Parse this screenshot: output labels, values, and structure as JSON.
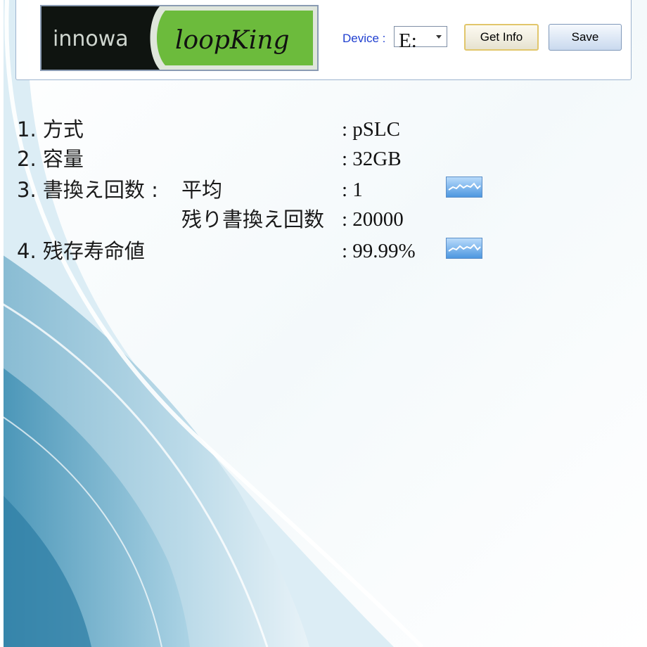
{
  "header": {
    "logo": {
      "brand_left": "innowa",
      "brand_right": "loopKing"
    },
    "device": {
      "label": "Device :",
      "value": "E:"
    },
    "buttons": {
      "get_info": "Get Info",
      "save": "Save"
    }
  },
  "info": {
    "row1": {
      "label": "1. 方式",
      "value": ": pSLC"
    },
    "row2": {
      "label": "2. 容量",
      "value": ": 32GB"
    },
    "row3": {
      "label": "3. 書換え回数 :",
      "sub1": {
        "label": "平均",
        "value": ": 1"
      },
      "sub2": {
        "label": "残り書換え回数",
        "value": ": 20000"
      }
    },
    "row4": {
      "label": "4. 残存寿命値",
      "value": ": 99.99%"
    }
  },
  "icons": {
    "chart": "line-chart-icon"
  },
  "colors": {
    "device_label": "#1f3fd0",
    "logo_green": "#6cbb3c",
    "logo_dark": "#0f1410"
  }
}
